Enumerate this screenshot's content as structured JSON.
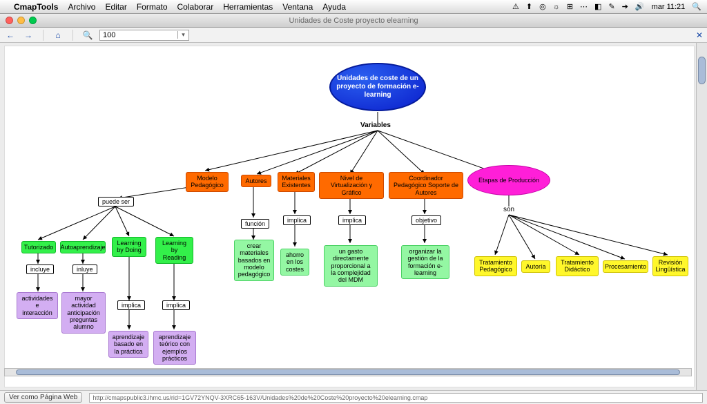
{
  "menubar": {
    "app": "CmapTools",
    "items": [
      "Archivo",
      "Editar",
      "Formato",
      "Colaborar",
      "Herramientas",
      "Ventana",
      "Ayuda"
    ],
    "clock": "mar 11:21",
    "status_icons": [
      "⚠",
      "⬆",
      "◎",
      "☼",
      "⊞",
      "⋯",
      "◧",
      "✎",
      "➔",
      "🔊"
    ]
  },
  "window": {
    "title": "Unidades de Coste proyecto elearning"
  },
  "toolbar": {
    "zoom": "100",
    "nav_back": "←",
    "nav_fwd": "→",
    "home": "⌂",
    "snap": "✕"
  },
  "bottom": {
    "button": "Ver como Página Web",
    "url": "http://cmapspublic3.ihmc.us/rid=1GV72YNQV-3XRC65-163V/Unidades%20de%20Coste%20proyecto%20elearning.cmap"
  },
  "diagram": {
    "root": "Unidades de coste de un proyecto de formación e-learning",
    "variables": "Variables",
    "top_nodes": {
      "modelo": "Modelo Pedagógico",
      "autores": "Autores",
      "materiales": "Materiales Existentes",
      "virt": "Nivel de Virtualización y Gráfico",
      "coord": "Coordinador Pedagógico Soporte de Autores",
      "etapas": "Etapas de Producción"
    },
    "links": {
      "puede_ser": "puede ser",
      "funcion": "función",
      "implica_mat": "implica",
      "implica_virt": "implica",
      "objetivo": "objetivo",
      "son": "son",
      "incluye1": "incluye",
      "incluye2": "inluye",
      "implica_ld": "implica",
      "implica_lr": "implica"
    },
    "model_branches": {
      "tutorizado": "Tutorizado",
      "auto": "Autoaprendizaje",
      "doing": "Learning by Doing",
      "reading": "Learning by Reading"
    },
    "leaves": {
      "act": "actividades e interacción",
      "mayor": "mayor actividad anticipación preguntas alumno",
      "prac": "aprendizaje basado en la práctica",
      "teor": "aprendizaje teórico con ejemplos prácticos",
      "crear": "crear materiales basados en modelo pedagógico",
      "ahorro": "ahorro en los costes",
      "gasto": "un gasto directamente proporcional a la complejidad del MDM",
      "org": "organizar la gestión de la formación e-learning"
    },
    "prod_stages": {
      "tp": "Tratamiento Pedagógico",
      "autoria": "Autoría",
      "td": "Tratamiento Didáctico",
      "proc": "Procesamiento",
      "rev": "Revisión Lingüística"
    }
  }
}
